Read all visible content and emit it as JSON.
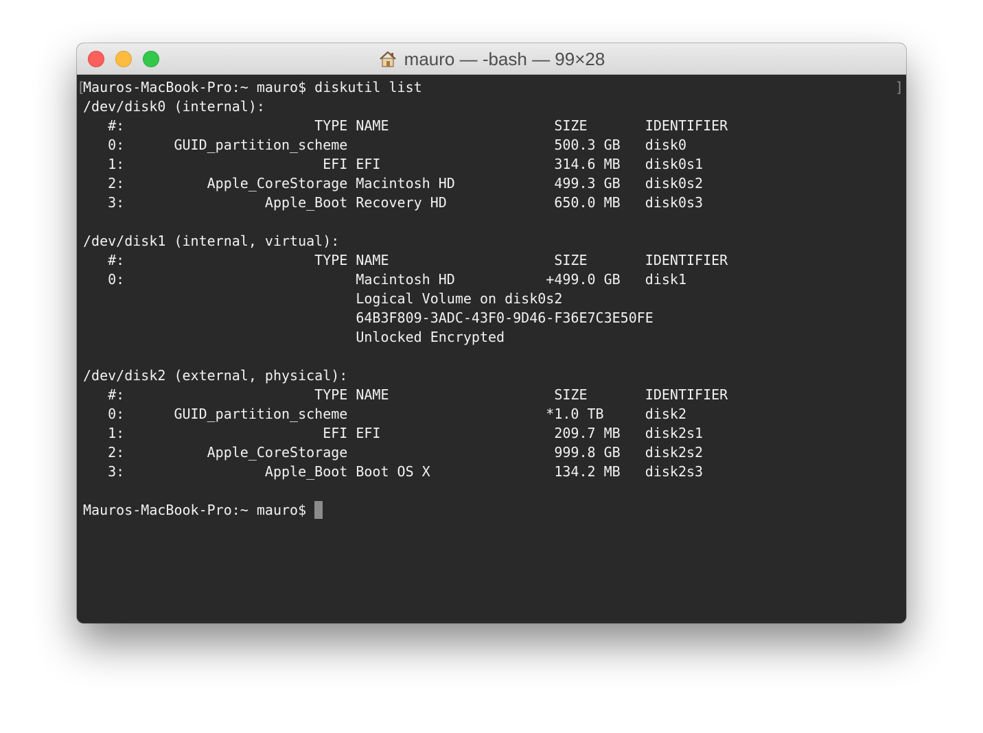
{
  "window": {
    "title": "mauro — -bash — 99×28",
    "title_icon": "home-icon"
  },
  "colors": {
    "terminal_bg": "#292929",
    "terminal_fg": "#f2f2f2",
    "close": "#fc605c",
    "minimize": "#fdbc40",
    "maximize": "#34c84a"
  },
  "terminal": {
    "lines": [
      "Mauros-MacBook-Pro:~ mauro$ diskutil list",
      "/dev/disk0 (internal):",
      "   #:                       TYPE NAME                    SIZE       IDENTIFIER",
      "   0:      GUID_partition_scheme                         500.3 GB   disk0",
      "   1:                        EFI EFI                     314.6 MB   disk0s1",
      "   2:          Apple_CoreStorage Macintosh HD            499.3 GB   disk0s2",
      "   3:                 Apple_Boot Recovery HD             650.0 MB   disk0s3",
      "",
      "/dev/disk1 (internal, virtual):",
      "   #:                       TYPE NAME                    SIZE       IDENTIFIER",
      "   0:                            Macintosh HD           +499.0 GB   disk1",
      "                                 Logical Volume on disk0s2",
      "                                 64B3F809-3ADC-43F0-9D46-F36E7C3E50FE",
      "                                 Unlocked Encrypted",
      "",
      "/dev/disk2 (external, physical):",
      "   #:                       TYPE NAME                    SIZE       IDENTIFIER",
      "   0:      GUID_partition_scheme                        *1.0 TB     disk2",
      "   1:                        EFI EFI                     209.7 MB   disk2s1",
      "   2:          Apple_CoreStorage                         999.8 GB   disk2s2",
      "   3:                 Apple_Boot Boot OS X               134.2 MB   disk2s3",
      ""
    ],
    "prompt": "Mauros-MacBook-Pro:~ mauro$",
    "bracket_left": "[",
    "bracket_right": "]"
  }
}
